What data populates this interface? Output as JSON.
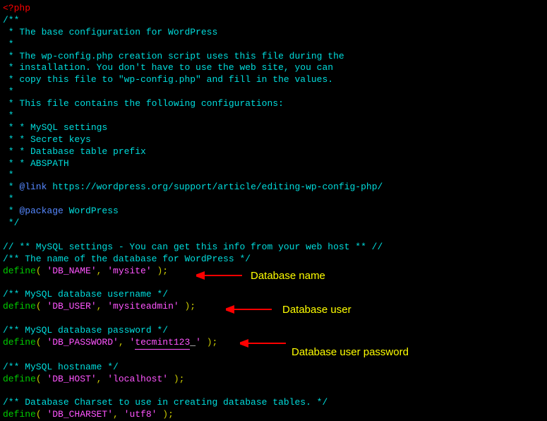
{
  "code": {
    "php_open": "<?php",
    "doc_open": "/**",
    "star": " *",
    "l1": " * The base configuration for WordPress",
    "l2": " * The wp-config.php creation script uses this file during the",
    "l3": " * installation. You don't have to use the web site, you can",
    "l4": " * copy this file to \"wp-config.php\" and fill in the values.",
    "l5": " * This file contains the following configurations:",
    "l6": " * * MySQL settings",
    "l7": " * * Secret keys",
    "l8": " * * Database table prefix",
    "l9": " * * ABSPATH",
    "link_prefix": " * ",
    "link_tag": "@link",
    "link_url": " https://wordpress.org/support/article/editing-wp-config-php/",
    "pkg_tag": "@package",
    "pkg_name": " WordPress",
    "doc_close": " */",
    "mysql_hdr_a": "// ** MySQL settings - You can get this info from your web host ** //",
    "mysql_hdr_b": "/** The name of the database for WordPress */",
    "define": "define",
    "paren_open": "( ",
    "dbname_key": "'DB_NAME'",
    "comma": ", ",
    "dbname_val": "'mysite'",
    "close": " );",
    "dbuser_hdr": "/** MySQL database username */",
    "dbuser_key": "'DB_USER'",
    "dbuser_val": "'mysiteadmin'",
    "dbpass_hdr": "/** MySQL database password */",
    "dbpass_key": "'DB_PASSWORD'",
    "dbpass_val_pre": "'",
    "dbpass_val_u": "tecmint123",
    "dbpass_val_post": "'",
    "dbpass_cursor": "_",
    "dbhost_hdr": "/** MySQL hostname */",
    "dbhost_key": "'DB_HOST'",
    "dbhost_val": "'localhost'",
    "dbchar_hdr": "/** Database Charset to use in creating database tables. */",
    "dbchar_key": "'DB_CHARSET'",
    "dbchar_val": "'utf8'"
  },
  "annotations": {
    "dbname": "Database name",
    "dbuser": "Database user",
    "dbpass": "Database user password"
  }
}
